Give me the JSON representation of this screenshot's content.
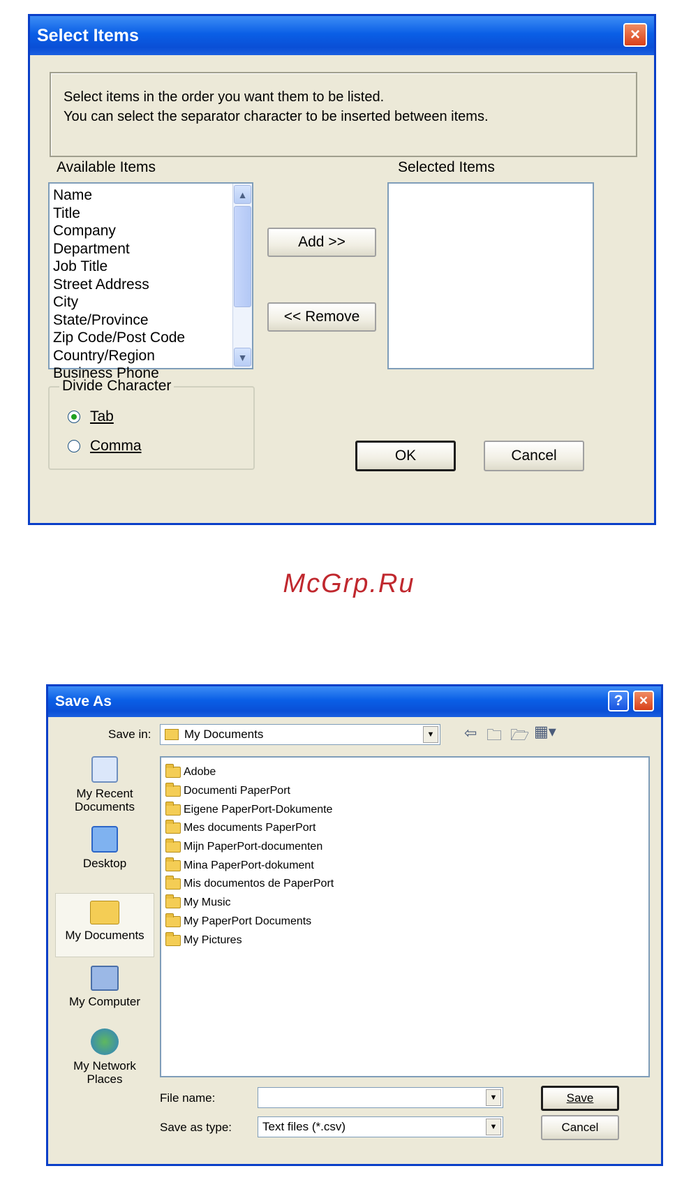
{
  "select_items": {
    "title": "Select Items",
    "close_label": "×",
    "instructions_line1": "Select items in the order you want them to be listed.",
    "instructions_line2": "You can select the separator character to be inserted between items.",
    "available_label": "Available Items",
    "selected_label": "Selected Items",
    "available_items": [
      "Name",
      "Title",
      "Company",
      "Department",
      "Job Title",
      "Street Address",
      "City",
      "State/Province",
      "Zip Code/Post Code",
      "Country/Region",
      "Business Phone"
    ],
    "add_button": "Add >>",
    "remove_button": "<< Remove",
    "divide_group_title": "Divide Character",
    "radio_tab": "Tab",
    "radio_comma": "Comma",
    "selected_radio": "Tab",
    "ok_button": "OK",
    "cancel_button": "Cancel"
  },
  "watermark": "McGrp.Ru",
  "save_as": {
    "title": "Save As",
    "help_label": "?",
    "close_label": "×",
    "save_in_label": "Save in:",
    "save_in_value": "My Documents",
    "places": [
      "My Recent Documents",
      "Desktop",
      "My Documents",
      "My Computer",
      "My Network Places"
    ],
    "active_place": "My Documents",
    "files": [
      {
        "name": "Adobe",
        "icon": "folder-icon"
      },
      {
        "name": "Documenti PaperPort",
        "icon": "folder-icon"
      },
      {
        "name": "Eigene PaperPort-Dokumente",
        "icon": "folder-icon"
      },
      {
        "name": "Mes documents PaperPort",
        "icon": "folder-icon"
      },
      {
        "name": "Mijn PaperPort-documenten",
        "icon": "folder-icon"
      },
      {
        "name": "Mina PaperPort-dokument",
        "icon": "folder-icon"
      },
      {
        "name": "Mis documentos de PaperPort",
        "icon": "folder-icon"
      },
      {
        "name": "My Music",
        "icon": "music-folder-icon"
      },
      {
        "name": "My PaperPort Documents",
        "icon": "folder-icon"
      },
      {
        "name": "My Pictures",
        "icon": "pictures-folder-icon"
      }
    ],
    "file_name_label": "File name:",
    "file_name_value": "",
    "save_type_label": "Save as type:",
    "save_type_value": "Text files (*.csv)",
    "save_button": "Save",
    "cancel_button": "Cancel"
  }
}
